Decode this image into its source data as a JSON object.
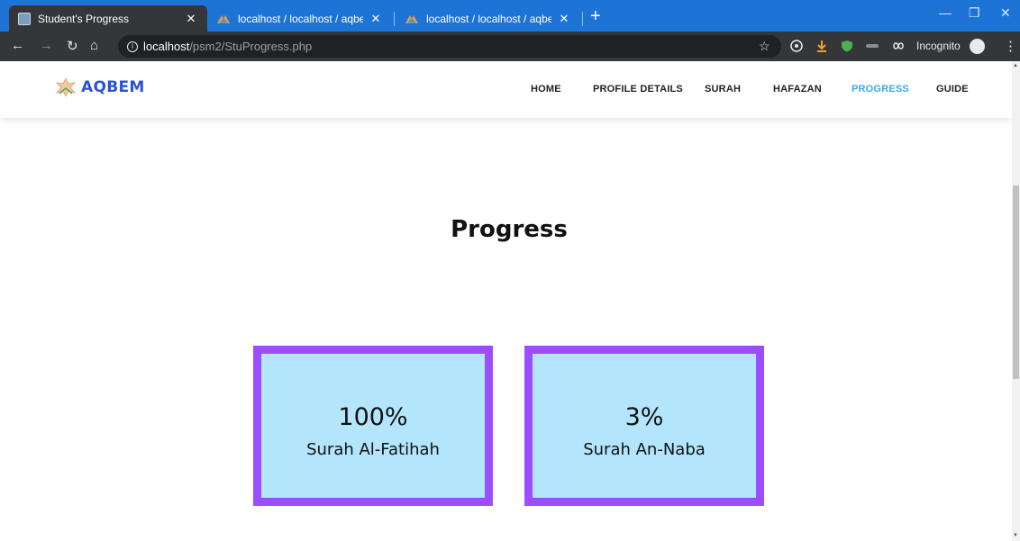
{
  "browser": {
    "tabs": [
      {
        "title": "Student's Progress",
        "active": true
      },
      {
        "title": "localhost / localhost / aqbem / st",
        "active": false
      },
      {
        "title": "localhost / localhost / aqbem / su",
        "active": false
      }
    ],
    "new_tab_label": "+",
    "url_host": "localhost",
    "url_path": "/psm2/StuProgress.php",
    "incognito_label": "Incognito",
    "window_controls": {
      "minimize": "—",
      "restore": "❐",
      "close": "✕"
    }
  },
  "site": {
    "logo_text": "AQBEM",
    "nav": [
      {
        "label": "HOME",
        "active": false
      },
      {
        "label": "PROFILE DETAILS",
        "active": false
      },
      {
        "label": "SURAH",
        "active": false
      },
      {
        "label": "HAFAZAN",
        "active": false
      },
      {
        "label": "PROGRESS",
        "active": true
      },
      {
        "label": "GUIDE",
        "active": false
      }
    ]
  },
  "main": {
    "title": "Progress",
    "cards": [
      {
        "percent": "100%",
        "name": "Surah Al-Fatihah"
      },
      {
        "percent": "3%",
        "name": "Surah An-Naba"
      }
    ]
  },
  "colors": {
    "titlebar": "#1e74d6",
    "nav_active": "#3fa9e4",
    "card_bg": "#b3e5fc",
    "card_border": "#9c4dff",
    "logo": "#2b52d6"
  }
}
